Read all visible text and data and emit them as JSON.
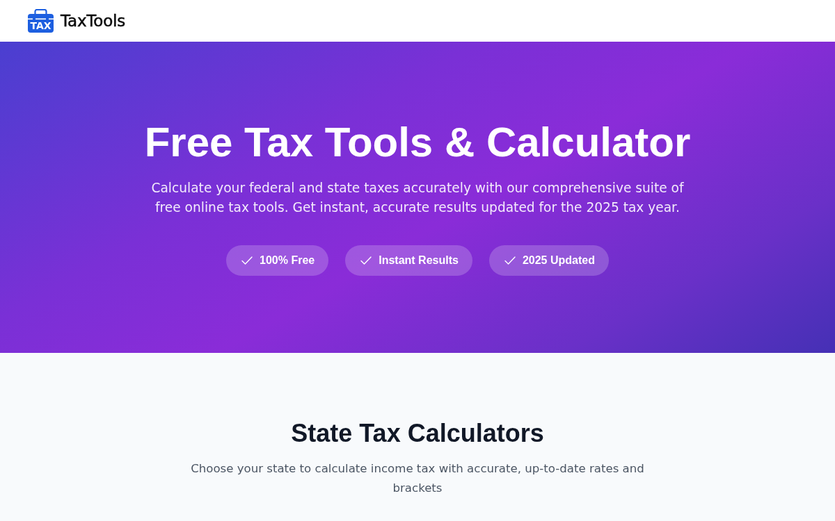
{
  "header": {
    "logo": {
      "icon_text": "TAX",
      "name": "TaxTools"
    }
  },
  "hero": {
    "title": "Free Tax Tools & Calculator",
    "subtitle": "Calculate your federal and state taxes accurately with our comprehensive suite of free online tax tools. Get instant, accurate results updated for the 2025 tax year.",
    "badges": [
      "100% Free",
      "Instant Results",
      "2025 Updated"
    ]
  },
  "section": {
    "title": "State Tax Calculators",
    "subtitle": "Choose your state to calculate income tax with accurate, up-to-date rates and brackets"
  }
}
